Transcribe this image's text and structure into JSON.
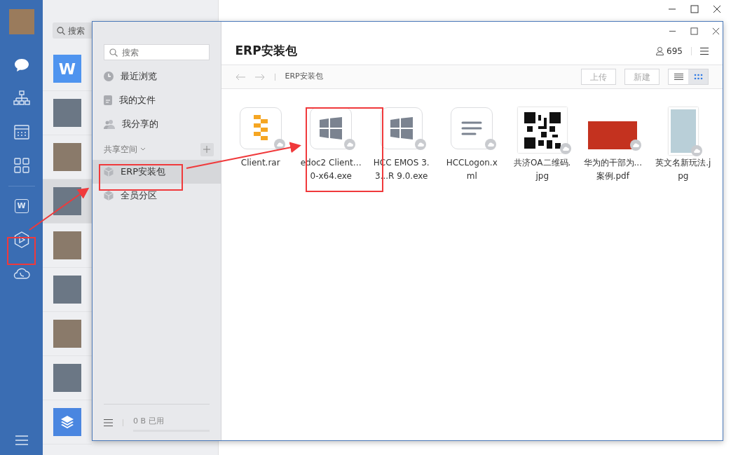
{
  "rail": {
    "items": [
      {
        "kind": "chat"
      },
      {
        "kind": "org"
      },
      {
        "kind": "calendar"
      },
      {
        "kind": "apps"
      },
      {
        "kind": "doc",
        "text": "W"
      },
      {
        "kind": "drive"
      },
      {
        "kind": "cloud"
      }
    ]
  },
  "chat_list": {
    "search": {
      "placeholder": "搜索"
    },
    "items": [
      {
        "kind": "logo",
        "text": "W",
        "selected": false
      },
      {
        "kind": "photo",
        "selected": false
      },
      {
        "kind": "photo",
        "selected": false
      },
      {
        "kind": "photo",
        "selected": true
      },
      {
        "kind": "photo",
        "selected": false
      },
      {
        "kind": "photo",
        "selected": false
      },
      {
        "kind": "photo",
        "selected": false
      },
      {
        "kind": "photo",
        "selected": false
      },
      {
        "kind": "layers",
        "selected": false
      }
    ]
  },
  "drive_window": {
    "sidebar": {
      "search": {
        "placeholder": "搜索"
      },
      "nav": [
        {
          "kind": "clock",
          "label": "最近浏览"
        },
        {
          "kind": "file",
          "label": "我的文件"
        },
        {
          "kind": "users",
          "label": "我分享的"
        }
      ],
      "section": {
        "label": "共享空间",
        "expanded": true
      },
      "spaces": [
        {
          "label": "ERP安装包",
          "selected": true
        },
        {
          "label": "全员分区",
          "selected": false
        }
      ],
      "usage": {
        "label": "0 B 已用"
      }
    },
    "header": {
      "title": "ERP安装包",
      "members": "695"
    },
    "toolbar": {
      "breadcrumb": "ERP安装包",
      "buttons": [
        {
          "label": "上传",
          "disabled": true
        },
        {
          "label": "新建",
          "disabled": true
        }
      ],
      "views": [
        {
          "kind": "list",
          "selected": false
        },
        {
          "kind": "grid",
          "selected": true
        }
      ]
    },
    "files": [
      {
        "kind": "archive",
        "lines": [
          "Client.rar"
        ]
      },
      {
        "kind": "exe",
        "lines": [
          "edoc2 Client…",
          "0-x64.exe"
        ]
      },
      {
        "kind": "exe",
        "lines": [
          "HCC EMOS 3.",
          "3...R 9.0.exe"
        ]
      },
      {
        "kind": "text",
        "lines": [
          "HCCLogon.x",
          "ml"
        ]
      },
      {
        "kind": "qr",
        "lines": [
          "共济OA二维码.",
          "jpg"
        ]
      },
      {
        "kind": "banner",
        "lines": [
          "华为的干部为...",
          "案例.pdf"
        ]
      },
      {
        "kind": "poster",
        "lines": [
          "英文名新玩法.j",
          "pg"
        ]
      }
    ]
  }
}
